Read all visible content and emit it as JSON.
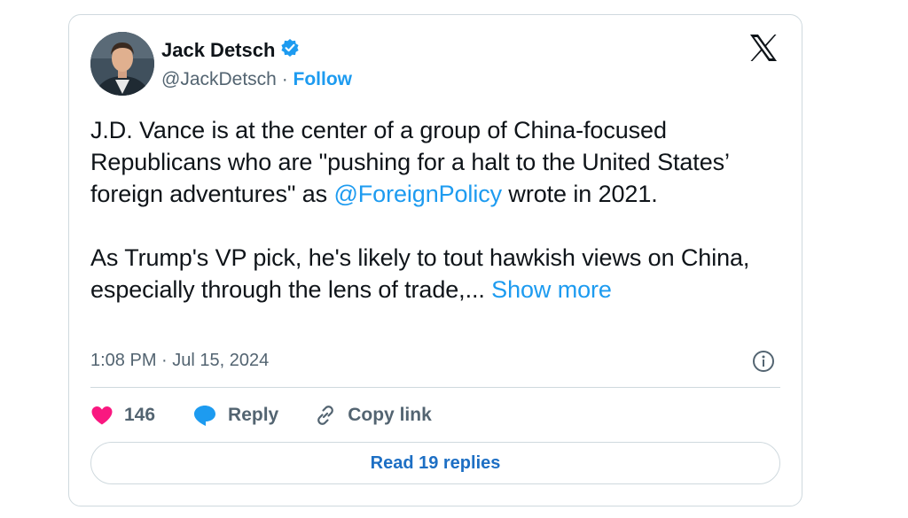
{
  "author": {
    "name": "Jack Detsch",
    "handle": "@JackDetsch",
    "separator": " · ",
    "follow_label": "Follow",
    "verified": true
  },
  "tweet": {
    "para1_before": "J.D. Vance is at the center of a group of China-focused Republicans who are \"pushing for a halt to the United States’ foreign adventures\" as ",
    "mention": "@ForeignPolicy",
    "para1_after": " wrote in 2021.",
    "para2": "As Trump's VP pick, he's likely to tout hawkish views on China, especially through the lens of trade,... ",
    "show_more": "Show more",
    "timestamp": "1:08 PM · Jul 15, 2024"
  },
  "actions": {
    "like_count": "146",
    "reply_label": "Reply",
    "copy_link_label": "Copy link"
  },
  "replies_button": "Read 19 replies",
  "colors": {
    "accent": "#1d9bf0",
    "like": "#f91880",
    "secondary_text": "#536471",
    "border": "#cfd9de"
  },
  "icons": [
    "verified-badge-icon",
    "x-logo-icon",
    "info-icon",
    "heart-icon",
    "reply-bubble-icon",
    "link-icon"
  ]
}
